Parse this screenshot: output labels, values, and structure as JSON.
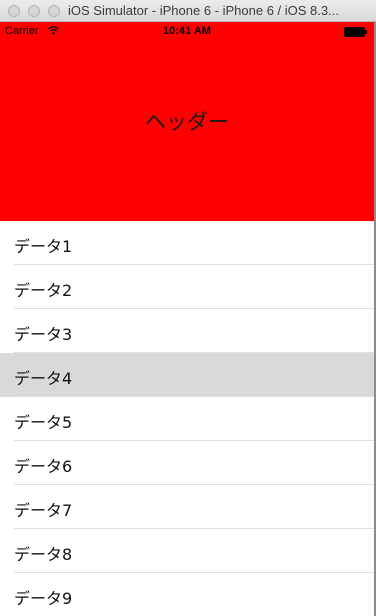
{
  "window": {
    "title": "iOS Simulator - iPhone 6 - iPhone 6 / iOS 8.3..."
  },
  "status_bar": {
    "carrier": "Carrier",
    "time": "10:41 AM",
    "wifi_icon": "wifi-icon",
    "battery_icon": "battery-icon"
  },
  "header": {
    "title": "ヘッダー",
    "background": "#ff0000"
  },
  "colors": {
    "selected_row": "#d9d9d9",
    "separator": "#e0e0e0"
  },
  "rows": [
    {
      "label": "データ1",
      "selected": false
    },
    {
      "label": "データ2",
      "selected": false
    },
    {
      "label": "データ3",
      "selected": false
    },
    {
      "label": "データ4",
      "selected": true
    },
    {
      "label": "データ5",
      "selected": false
    },
    {
      "label": "データ6",
      "selected": false
    },
    {
      "label": "データ7",
      "selected": false
    },
    {
      "label": "データ8",
      "selected": false
    },
    {
      "label": "データ9",
      "selected": false
    }
  ]
}
